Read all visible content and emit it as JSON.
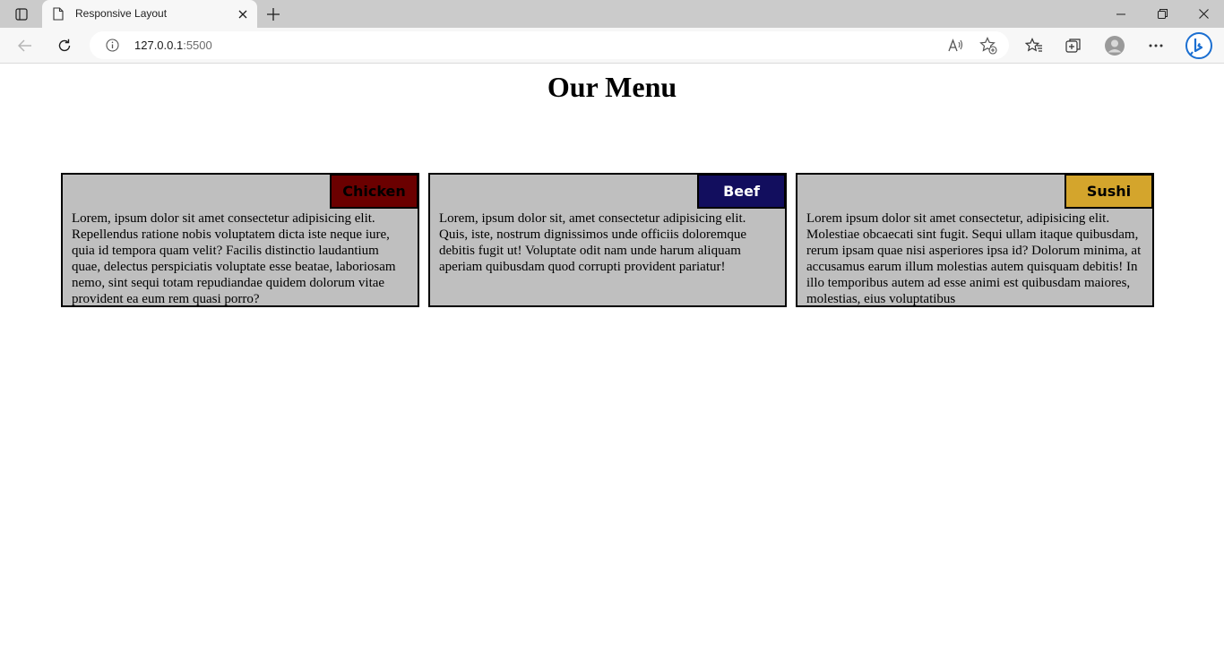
{
  "browser": {
    "tab_title": "Responsive Layout",
    "url_host": "127.0.0.1",
    "url_port": ":5500"
  },
  "page": {
    "title": "Our Menu",
    "cards": [
      {
        "badge": "Chicken",
        "badge_color": "#6b0000",
        "badge_text_color": "#000000",
        "text": "Lorem, ipsum dolor sit amet consectetur adipisicing elit. Repellendus ratione nobis voluptatem dicta iste neque iure, quia id tempora quam velit? Facilis distinctio laudantium quae, delectus perspiciatis voluptate esse beatae, laboriosam nemo, sint sequi totam repudiandae quidem dolorum vitae provident ea eum rem quasi porro?"
      },
      {
        "badge": "Beef",
        "badge_color": "#120e5e",
        "badge_text_color": "#ffffff",
        "text": "Lorem, ipsum dolor sit, amet consectetur adipisicing elit. Quis, iste, nostrum dignissimos unde officiis doloremque debitis fugit ut! Voluptate odit nam unde harum aliquam aperiam quibusdam quod corrupti provident pariatur!"
      },
      {
        "badge": "Sushi",
        "badge_color": "#d4a52c",
        "badge_text_color": "#000000",
        "text": "Lorem ipsum dolor sit amet consectetur, adipisicing elit. Molestiae obcaecati sint fugit. Sequi ullam itaque quibusdam, rerum ipsam quae nisi asperiores ipsa id? Dolorum minima, at accusamus earum illum molestias autem quisquam debitis! In illo temporibus autem ad esse animi est quibusdam maiores, molestias, eius voluptatibus"
      }
    ]
  }
}
